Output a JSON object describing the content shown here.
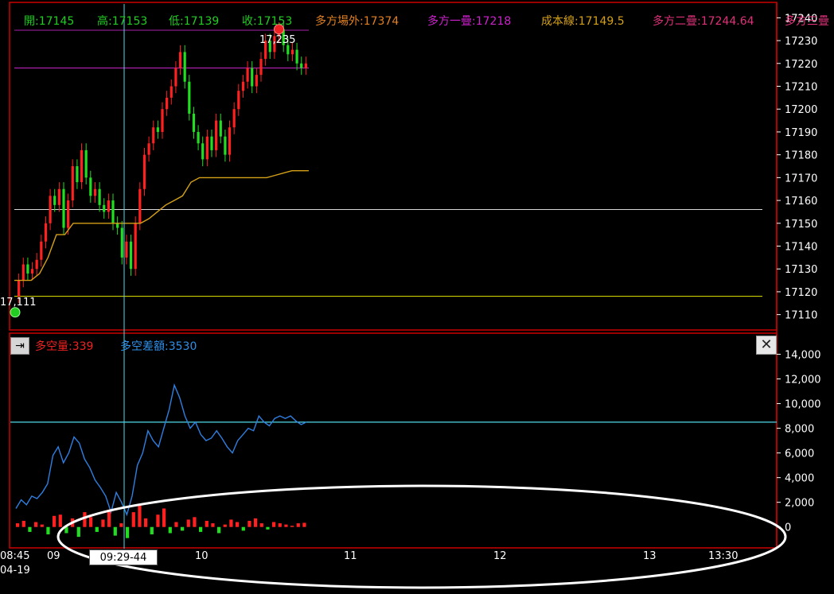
{
  "info_bar": {
    "open": "開:17145",
    "high": "高:17153",
    "low": "低:17139",
    "close": "收:17153",
    "long_outside": "多方場外:17374",
    "long_layer1": "多方一疊:17218",
    "cost_line": "成本線:17149.5",
    "long_layer2": "多方二疊:17244.64",
    "long_layer3": "多方三疊"
  },
  "indicator_bar": {
    "long_short_volume": "多空量:339",
    "long_short_diff": "多空差額:3530"
  },
  "annotations": {
    "high_label": "17,235",
    "low_label": "17,111",
    "crosshair_time": "09:29-44"
  },
  "time_axis": {
    "start_time": "08:45",
    "start_date": "04-19",
    "labels": [
      "09",
      "10",
      "11",
      "12",
      "13",
      "13:30"
    ]
  },
  "colors": {
    "background": "#000000",
    "border": "#cc0000",
    "up_candle": "#ff2020",
    "down_candle": "#22dd22",
    "cost_line": "#d4a017",
    "long_layer1": "#aa22aa",
    "support_white": "#d8d8d8",
    "support_yellow": "#e6e600",
    "diff_line": "#2f7fe0",
    "crosshair": "#4fd8e8"
  },
  "chart_data": [
    {
      "type": "line",
      "title": "",
      "ylim": [
        17105,
        17245
      ],
      "yticks": [
        17110,
        17120,
        17130,
        17140,
        17150,
        17160,
        17170,
        17180,
        17190,
        17200,
        17210,
        17220,
        17230,
        17240
      ],
      "price_series": [
        17118,
        17125,
        17132,
        17128,
        17130,
        17134,
        17142,
        17150,
        17162,
        17158,
        17165,
        17148,
        17160,
        17175,
        17168,
        17182,
        17170,
        17162,
        17165,
        17158,
        17155,
        17160,
        17150,
        17148,
        17135,
        17142,
        17130,
        17150,
        17165,
        17180,
        17185,
        17192,
        17190,
        17200,
        17205,
        17210,
        17218,
        17225,
        17212,
        17198,
        17190,
        17185,
        17178,
        17188,
        17182,
        17195,
        17188,
        17180,
        17192,
        17200,
        17208,
        17212,
        17218,
        17210,
        17215,
        17222,
        17230,
        17225,
        17232,
        17235,
        17228,
        17224,
        17226,
        17220,
        17218,
        17220
      ],
      "cost_line_series": [
        17125,
        17125,
        17125,
        17128,
        17135,
        17145,
        17145,
        17150,
        17150,
        17150,
        17150,
        17150,
        17150,
        17150,
        17150,
        17150,
        17152,
        17155,
        17158,
        17160,
        17162,
        17168,
        17170,
        17170,
        17170,
        17170,
        17170,
        17170,
        17170,
        17170,
        17170,
        17171,
        17172,
        17173,
        17173,
        17173
      ],
      "levels": {
        "long_layer1": 17218,
        "white_support": 17156,
        "yellow_support": 17118
      },
      "high": 17235,
      "low": 17111
    },
    {
      "type": "line",
      "title": "",
      "ylim": [
        -1500,
        15000
      ],
      "yticks": [
        0,
        2000,
        4000,
        6000,
        8000,
        10000,
        12000,
        14000
      ],
      "ytick_labels": [
        "0",
        "2,000",
        "4,000",
        "6,000",
        "8,000",
        "10,000",
        "12,000",
        "14,000"
      ],
      "reference_level": 8500,
      "series": [
        {
          "values": [
            1500,
            2200,
            1800,
            2500,
            2300,
            2800,
            3500,
            5800,
            6500,
            5200,
            6000,
            7300,
            6800,
            5500,
            4800,
            3800,
            3200,
            2500,
            1200,
            2800,
            2000,
            1000,
            2500,
            5000,
            6000,
            7800,
            7000,
            6500,
            8000,
            9500,
            11500,
            10500,
            9000,
            8000,
            8500,
            7500,
            7000,
            7200,
            7800,
            7200,
            6500,
            6000,
            7000,
            7500,
            8000,
            7800,
            9000,
            8500,
            8200,
            8800,
            9000,
            8800,
            9000,
            8600,
            8300,
            8500
          ]
        },
        {
          "values": [
            300,
            500,
            -400,
            400,
            200,
            -600,
            900,
            1000,
            -500,
            700,
            -800,
            1200,
            800,
            -400,
            600,
            1400,
            -700,
            300,
            -900,
            1200,
            1800,
            700,
            -600,
            1000,
            1500,
            -500,
            400,
            -300,
            600,
            800,
            -400,
            500,
            300,
            -500,
            200,
            600,
            400,
            -300,
            500,
            700,
            300,
            -200,
            400,
            300,
            200,
            100,
            300,
            339
          ]
        }
      ]
    }
  ]
}
